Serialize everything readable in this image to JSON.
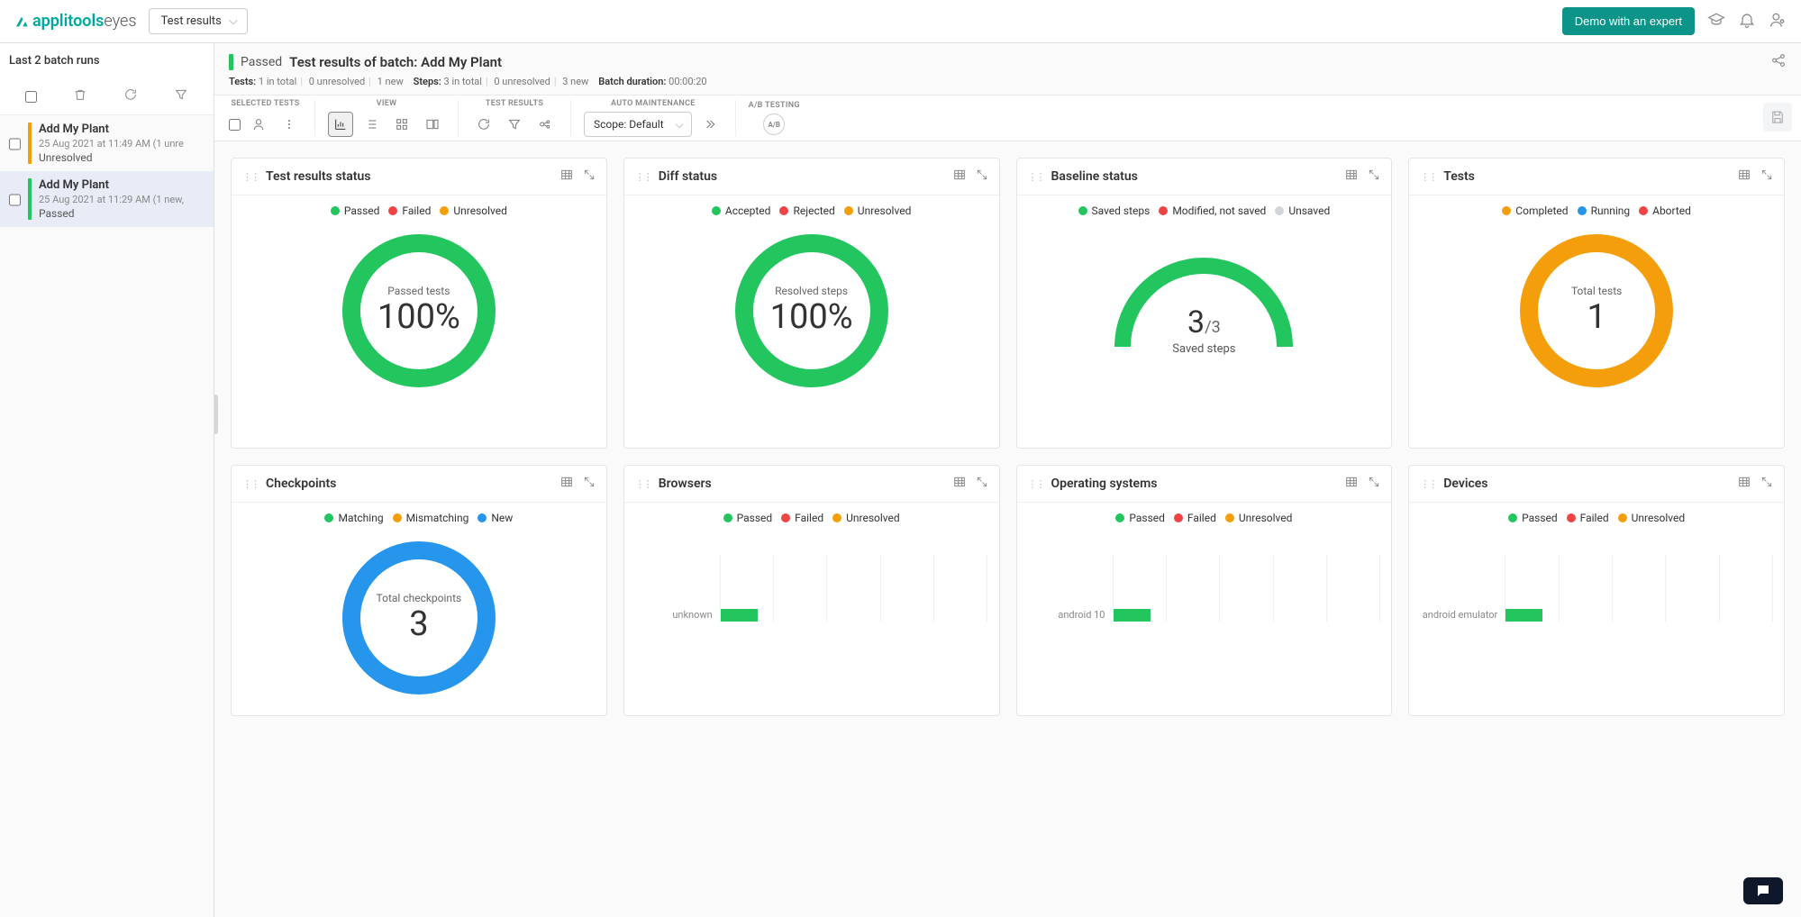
{
  "brand": {
    "name1": "applitools",
    "name2": "eyes"
  },
  "headerDropdown": "Test results",
  "demoButton": "Demo with an expert",
  "sidebar": {
    "header": "Last 2 batch runs",
    "items": [
      {
        "title": "Add My Plant",
        "date": "25 Aug 2021 at 11:49 AM  (1 unre",
        "status": "Unresolved",
        "kind": "unresolved"
      },
      {
        "title": "Add My Plant",
        "date": "25 Aug 2021 at 11:29 AM  (1 new,",
        "status": "Passed",
        "kind": "passed"
      }
    ]
  },
  "batchHeader": {
    "status": "Passed",
    "title": "Test results of batch: Add My Plant",
    "testsLabel": "Tests:",
    "testsTotal": "1 in total",
    "testsUnresolved": "0 unresolved",
    "testsNew": "1 new",
    "stepsLabel": "Steps:",
    "stepsTotal": "3 in total",
    "stepsUnresolved": "0 unresolved",
    "stepsNew": "3 new",
    "durationLabel": "Batch duration:",
    "durationValue": "00:00:20"
  },
  "toolbarLabels": {
    "selected": "SELECTED TESTS",
    "view": "VIEW",
    "testResults": "TEST RESULTS",
    "autoMaint": "AUTO MAINTENANCE",
    "ab": "A/B TESTING"
  },
  "scope": "Scope: Default",
  "cards": {
    "testResults": {
      "title": "Test results status",
      "legend": [
        "Passed",
        "Failed",
        "Unresolved"
      ],
      "centerSmall": "Passed tests",
      "centerBig": "100%"
    },
    "diff": {
      "title": "Diff status",
      "legend": [
        "Accepted",
        "Rejected",
        "Unresolved"
      ],
      "centerSmall": "Resolved steps",
      "centerBig": "100%"
    },
    "baseline": {
      "title": "Baseline status",
      "legend": [
        "Saved steps",
        "Modified, not saved",
        "Unsaved"
      ],
      "num": "3",
      "den": "/3",
      "glabel": "Saved steps"
    },
    "tests": {
      "title": "Tests",
      "legend": [
        "Completed",
        "Running",
        "Aborted"
      ],
      "centerSmall": "Total tests",
      "centerBig": "1"
    },
    "checkpoints": {
      "title": "Checkpoints",
      "legend": [
        "Matching",
        "Mismatching",
        "New"
      ],
      "centerSmall": "Total checkpoints",
      "centerBig": "3"
    },
    "browsers": {
      "title": "Browsers",
      "legend": [
        "Passed",
        "Failed",
        "Unresolved"
      ],
      "rowLabel": "unknown"
    },
    "os": {
      "title": "Operating systems",
      "legend": [
        "Passed",
        "Failed",
        "Unresolved"
      ],
      "rowLabel": "android 10"
    },
    "devices": {
      "title": "Devices",
      "legend": [
        "Passed",
        "Failed",
        "Unresolved"
      ],
      "rowLabel": "android emulator"
    }
  },
  "chart_data": [
    {
      "type": "pie",
      "title": "Test results status",
      "series": [
        {
          "name": "Passed",
          "value": 100
        },
        {
          "name": "Failed",
          "value": 0
        },
        {
          "name": "Unresolved",
          "value": 0
        }
      ],
      "center_label": "Passed tests",
      "center_value": "100%"
    },
    {
      "type": "pie",
      "title": "Diff status",
      "series": [
        {
          "name": "Accepted",
          "value": 100
        },
        {
          "name": "Rejected",
          "value": 0
        },
        {
          "name": "Unresolved",
          "value": 0
        }
      ],
      "center_label": "Resolved steps",
      "center_value": "100%"
    },
    {
      "type": "pie",
      "title": "Baseline status (gauge)",
      "series": [
        {
          "name": "Saved steps",
          "value": 3
        },
        {
          "name": "Modified, not saved",
          "value": 0
        },
        {
          "name": "Unsaved",
          "value": 0
        }
      ],
      "total": 3,
      "center_label": "Saved steps"
    },
    {
      "type": "pie",
      "title": "Tests",
      "series": [
        {
          "name": "Completed",
          "value": 1
        },
        {
          "name": "Running",
          "value": 0
        },
        {
          "name": "Aborted",
          "value": 0
        }
      ],
      "center_label": "Total tests",
      "center_value": "1"
    },
    {
      "type": "pie",
      "title": "Checkpoints",
      "series": [
        {
          "name": "Matching",
          "value": 0
        },
        {
          "name": "Mismatching",
          "value": 0
        },
        {
          "name": "New",
          "value": 3
        }
      ],
      "center_label": "Total checkpoints",
      "center_value": "3"
    },
    {
      "type": "bar",
      "title": "Browsers",
      "categories": [
        "unknown"
      ],
      "series": [
        {
          "name": "Passed",
          "values": [
            1
          ]
        },
        {
          "name": "Failed",
          "values": [
            0
          ]
        },
        {
          "name": "Unresolved",
          "values": [
            0
          ]
        }
      ]
    },
    {
      "type": "bar",
      "title": "Operating systems",
      "categories": [
        "android 10"
      ],
      "series": [
        {
          "name": "Passed",
          "values": [
            1
          ]
        },
        {
          "name": "Failed",
          "values": [
            0
          ]
        },
        {
          "name": "Unresolved",
          "values": [
            0
          ]
        }
      ]
    },
    {
      "type": "bar",
      "title": "Devices",
      "categories": [
        "android emulator"
      ],
      "series": [
        {
          "name": "Passed",
          "values": [
            1
          ]
        },
        {
          "name": "Failed",
          "values": [
            0
          ]
        },
        {
          "name": "Unresolved",
          "values": [
            0
          ]
        }
      ]
    }
  ]
}
